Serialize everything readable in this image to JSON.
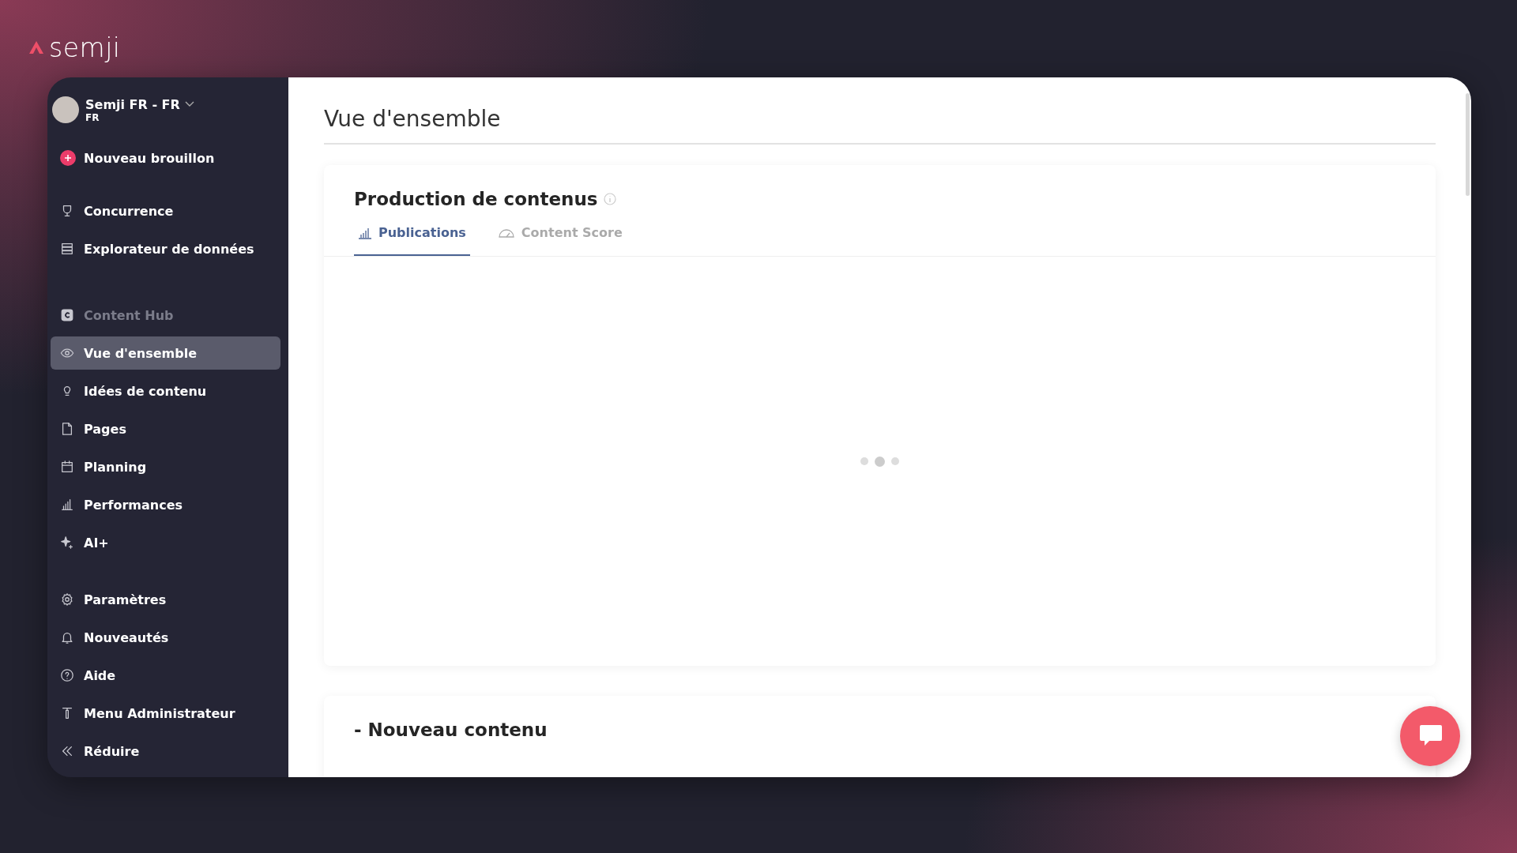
{
  "logo": {
    "text": "semji"
  },
  "sidebar": {
    "workspace": {
      "name": "Semji FR - FR",
      "sub": "FR"
    },
    "new_draft": {
      "label": "Nouveau brouillon"
    },
    "sections": [
      {
        "items": [
          {
            "label": "Concurrence",
            "kind": "item",
            "selected": false
          },
          {
            "label": "Explorateur de données",
            "kind": "item",
            "selected": false
          }
        ]
      },
      {
        "items": [
          {
            "label": "Content Hub",
            "kind": "header"
          },
          {
            "label": "Vue d'ensemble",
            "kind": "item",
            "selected": true
          },
          {
            "label": "Idées de contenu",
            "kind": "item",
            "selected": false
          },
          {
            "label": "Pages",
            "kind": "item",
            "selected": false
          },
          {
            "label": "Planning",
            "kind": "item",
            "selected": false
          },
          {
            "label": "Performances",
            "kind": "item",
            "selected": false
          },
          {
            "label": "AI+",
            "kind": "item",
            "selected": false
          }
        ]
      },
      {
        "items": [
          {
            "label": "Paramètres",
            "kind": "item",
            "selected": false
          },
          {
            "label": "Nouveautés",
            "kind": "item",
            "selected": false
          },
          {
            "label": "Aide",
            "kind": "item",
            "selected": false
          },
          {
            "label": "Menu Administrateur",
            "kind": "item",
            "selected": false
          },
          {
            "label": "Réduire",
            "kind": "item",
            "selected": false
          }
        ]
      }
    ]
  },
  "page": {
    "title": "Vue d'ensemble"
  },
  "production_card": {
    "title": "Production de contenus",
    "tabs": [
      {
        "label": "Publications",
        "selected": true
      },
      {
        "label": "Content Score",
        "selected": false
      }
    ]
  },
  "new_content_card": {
    "title": "- Nouveau contenu"
  }
}
